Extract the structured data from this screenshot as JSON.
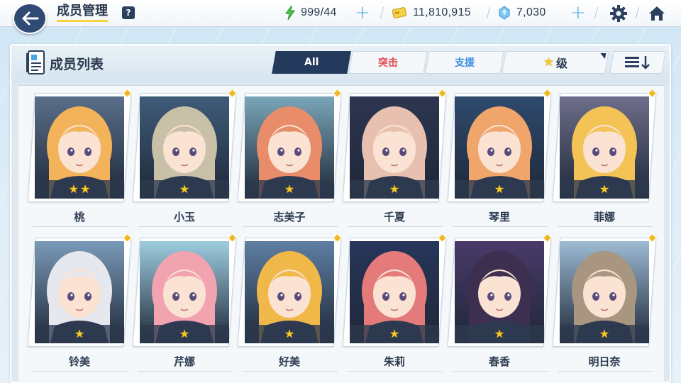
{
  "header": {
    "title": "成员管理",
    "help": "?",
    "stamina": "999/44",
    "credits": "11,810,915",
    "gems": "7,030"
  },
  "panel": {
    "title": "成员列表",
    "tabs": [
      "All",
      "突击",
      "支援"
    ],
    "sort_label": "级",
    "sort_star": "★"
  },
  "colors": {
    "accent_navy": "#233a5c",
    "assault_red": "#e0464c",
    "support_blue": "#3c8be0",
    "star_gold": "#f7c928"
  },
  "members": [
    {
      "name": "桃",
      "stars": 2,
      "hair": "#f2b35a",
      "bg": "#5a6f8a"
    },
    {
      "name": "小玉",
      "stars": 1,
      "hair": "#c9c0a8",
      "bg": "#3f5c7a"
    },
    {
      "name": "志美子",
      "stars": 1,
      "hair": "#e88c6a",
      "bg": "#7aa6b8"
    },
    {
      "name": "千夏",
      "stars": 1,
      "hair": "#e8c0b0",
      "bg": "#2d3550"
    },
    {
      "name": "琴里",
      "stars": 1,
      "hair": "#f0a56a",
      "bg": "#2f4a6e"
    },
    {
      "name": "菲娜",
      "stars": 1,
      "hair": "#f3c455",
      "bg": "#6e6e8a"
    },
    {
      "name": "铃美",
      "stars": 1,
      "hair": "#e6e8ee",
      "bg": "#7a9ab8"
    },
    {
      "name": "芹娜",
      "stars": 1,
      "hair": "#f2a3b0",
      "bg": "#9ecde0"
    },
    {
      "name": "好美",
      "stars": 1,
      "hair": "#f0b848",
      "bg": "#5e7fa2"
    },
    {
      "name": "朱莉",
      "stars": 1,
      "hair": "#e57a7a",
      "bg": "#27365a"
    },
    {
      "name": "春香",
      "stars": 1,
      "hair": "#3d2f4f",
      "bg": "#4a3a6a"
    },
    {
      "name": "明日奈",
      "stars": 1,
      "hair": "#a89680",
      "bg": "#9dbbd4"
    }
  ]
}
